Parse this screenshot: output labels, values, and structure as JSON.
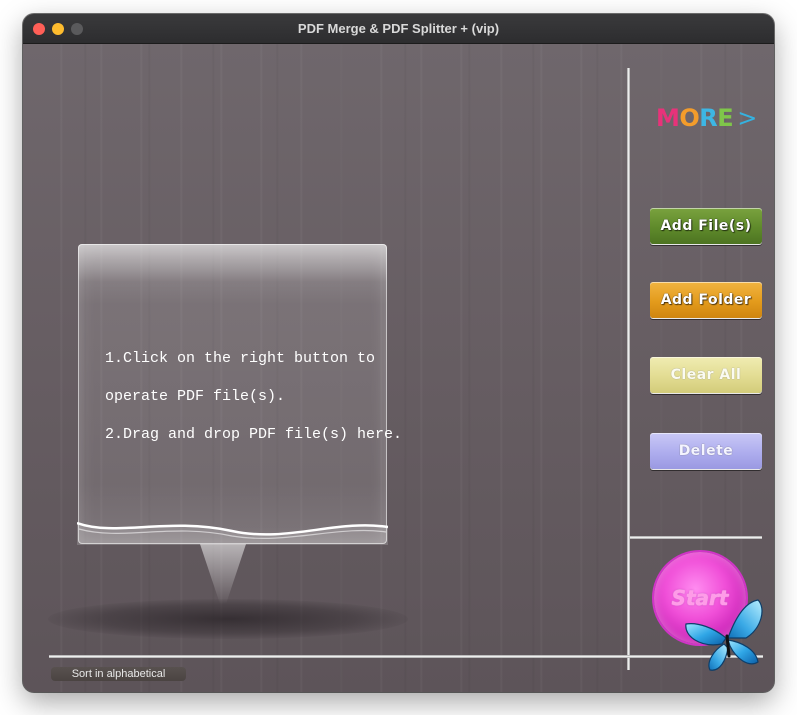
{
  "window": {
    "title": "PDF Merge & PDF Splitter + (vip)"
  },
  "more": {
    "letters": [
      "M",
      "O",
      "R",
      "E"
    ],
    "arrow": ">"
  },
  "buttons": {
    "add_files": "Add File(s)",
    "add_folder": "Add Folder",
    "clear_all": "Clear All",
    "delete": "Delete",
    "start": "Start",
    "sort": "Sort in alphabetical"
  },
  "instructions": {
    "line1": "1.Click on the right button to",
    "line2": "operate PDF file(s).",
    "line3": "2.Drag and drop PDF file(s) here."
  },
  "icons": {
    "traffic_close": "close-icon",
    "traffic_minimize": "minimize-icon",
    "traffic_zoom": "zoom-icon",
    "butterfly": "butterfly-icon"
  },
  "colors": {
    "add_files": "#6a9634",
    "add_folder": "#e8a22a",
    "clear_all": "#e4df98",
    "delete": "#b3b2ef",
    "start": "#e94ad3"
  }
}
